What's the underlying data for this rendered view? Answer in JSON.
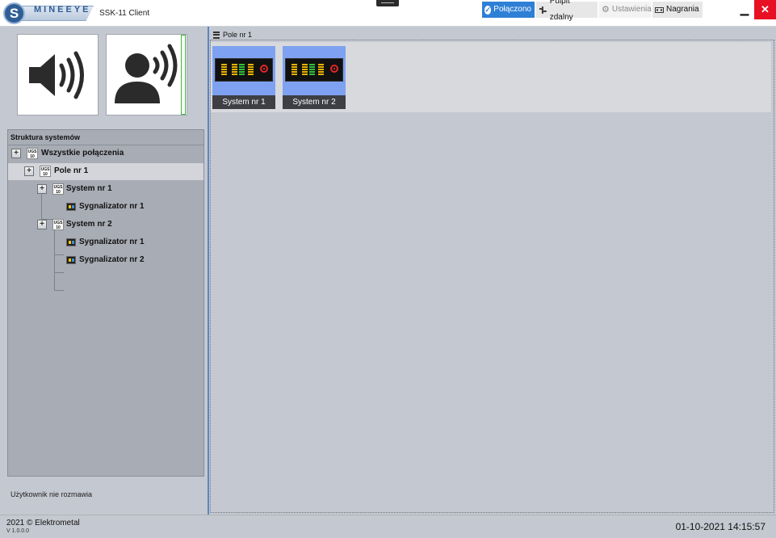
{
  "app": {
    "logo_letter": "S",
    "logo_text": "MINEEYE",
    "title": "SSK-11 Client"
  },
  "toolbar": {
    "connected_label": "Połączono",
    "remote_desk_label": "Pulpit zdalny",
    "settings_label": "Ustawienia",
    "recordings_label": "Nagrania",
    "minimize_glyph": "▁",
    "close_glyph": "✕"
  },
  "tree": {
    "header": "Struktura systemów",
    "nodes": [
      {
        "label": "Wszystkie połączenia",
        "icon": "ugs-icon"
      },
      {
        "label": "Pole nr 1",
        "icon": "ugs-icon"
      },
      {
        "label": "System nr 1",
        "icon": "ugs-icon"
      },
      {
        "label": "Sygnalizator nr 1",
        "icon": "signaler-icon"
      },
      {
        "label": "System nr 2",
        "icon": "ugs-icon"
      },
      {
        "label": "Sygnalizator nr 1",
        "icon": "signaler-icon"
      },
      {
        "label": "Sygnalizator nr 2",
        "icon": "signaler-icon"
      }
    ],
    "ugs_top": "UGS",
    "ugs_bottom": "10"
  },
  "status": {
    "call_status": "Użytkownik nie rozmawia"
  },
  "main": {
    "breadcrumb": "Pole nr 1",
    "systems": [
      {
        "label": "System nr 1"
      },
      {
        "label": "System nr 2"
      }
    ]
  },
  "footer": {
    "copyright": "2021 © Elektrometal",
    "version": "V 1.0.0.0",
    "datetime": "01-10-2021 14:15:57"
  },
  "colors": {
    "accent": "#2e7fd6",
    "close": "#e81123",
    "card_bg": "#7ea2f1"
  }
}
